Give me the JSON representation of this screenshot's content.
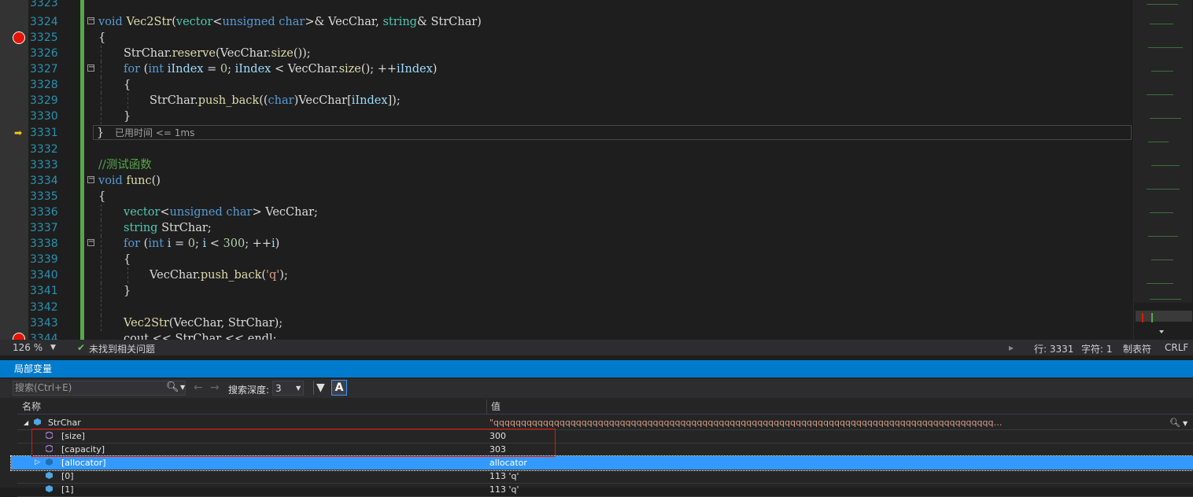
{
  "editor": {
    "lines": [
      {
        "num": "3323",
        "text": ""
      },
      {
        "num": "3324",
        "text": "void Vec2Str(vector<unsigned char>& VecChar, string& StrChar)",
        "breakpoint": false,
        "fold": true
      },
      {
        "num": "3325",
        "text": "{",
        "breakpoint": true
      },
      {
        "num": "3326",
        "text": "StrChar.reserve(VecChar.size());"
      },
      {
        "num": "3327",
        "text": "for (int iIndex = 0; iIndex < VecChar.size(); ++iIndex)",
        "fold": true
      },
      {
        "num": "3328",
        "text": "{"
      },
      {
        "num": "3329",
        "text": "StrChar.push_back((char)VecChar[iIndex]);"
      },
      {
        "num": "3330",
        "text": "}"
      },
      {
        "num": "3331",
        "text": "}",
        "current": true,
        "hint": "已用时间 <= 1ms"
      },
      {
        "num": "3332",
        "text": ""
      },
      {
        "num": "3333",
        "text": "//测试函数"
      },
      {
        "num": "3334",
        "text": "void func()",
        "fold": true
      },
      {
        "num": "3335",
        "text": "{"
      },
      {
        "num": "3336",
        "text": "vector<unsigned char> VecChar;"
      },
      {
        "num": "3337",
        "text": "string StrChar;"
      },
      {
        "num": "3338",
        "text": "for (int i = 0; i < 300; ++i)",
        "fold": true
      },
      {
        "num": "3339",
        "text": "{"
      },
      {
        "num": "3340",
        "text": "VecChar.push_back('q');"
      },
      {
        "num": "3341",
        "text": "}"
      },
      {
        "num": "3342",
        "text": ""
      },
      {
        "num": "3343",
        "text": "Vec2Str(VecChar, StrChar);"
      },
      {
        "num": "3344",
        "text": "cout << StrChar << endl;",
        "breakpoint": true
      }
    ]
  },
  "statusbar": {
    "zoom": "126 %",
    "issues": "未找到相关问题",
    "line": "行: 3331",
    "char": "字符: 1",
    "tabs": "制表符",
    "eol": "CRLF"
  },
  "locals": {
    "title": "局部变量",
    "search_placeholder": "搜索(Ctrl+E)",
    "depth_label": "搜索深度:",
    "depth_value": "3",
    "col_name": "名称",
    "col_value": "值",
    "rows": [
      {
        "name": "StrChar",
        "value": "\"qqqqqqqqqqqqqqqqqqqqqqqqqqqqqqqqqqqqqqqqqqqqqqqqqqqqqqqqqqqqqqqqqqqqqqqqqqqqqqqqqqqqqqqqqqq…",
        "level": 0
      },
      {
        "name": "[size]",
        "value": "300",
        "level": 1
      },
      {
        "name": "[capacity]",
        "value": "303",
        "level": 1
      },
      {
        "name": "[allocator]",
        "value": "allocator",
        "level": 1,
        "selected": true
      },
      {
        "name": "[0]",
        "value": "113 'q'",
        "level": 1
      },
      {
        "name": "[1]",
        "value": "113 'q'",
        "level": 1
      }
    ]
  },
  "colors": {
    "accent": "#007acc",
    "breakpoint": "#e51400",
    "selection": "#3399ff"
  }
}
